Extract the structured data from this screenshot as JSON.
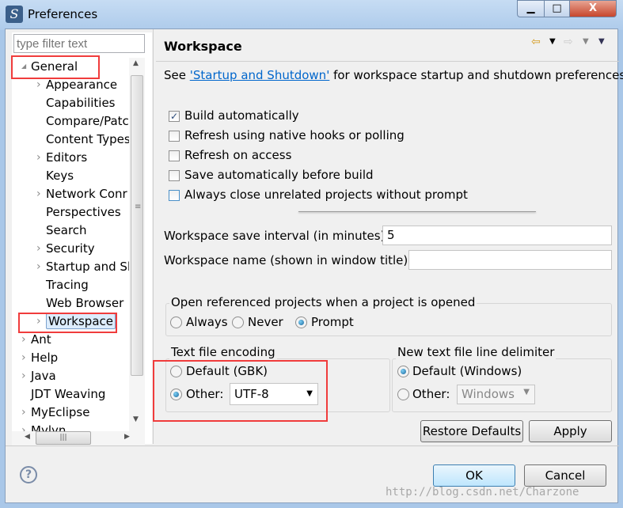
{
  "window": {
    "title": "Preferences",
    "minimize": "▁",
    "maximize": "□",
    "close": "X"
  },
  "sidebar": {
    "filter_placeholder": "type filter text",
    "items": [
      {
        "label": "General",
        "level": 0,
        "expanded": true
      },
      {
        "label": "Appearance",
        "level": 1,
        "arrow": true
      },
      {
        "label": "Capabilities",
        "level": 1
      },
      {
        "label": "Compare/Patc",
        "level": 1
      },
      {
        "label": "Content Types",
        "level": 1
      },
      {
        "label": "Editors",
        "level": 1,
        "arrow": true
      },
      {
        "label": "Keys",
        "level": 1
      },
      {
        "label": "Network Conr",
        "level": 1,
        "arrow": true
      },
      {
        "label": "Perspectives",
        "level": 1
      },
      {
        "label": "Search",
        "level": 1
      },
      {
        "label": "Security",
        "level": 1,
        "arrow": true
      },
      {
        "label": "Startup and Sh",
        "level": 1,
        "arrow": true
      },
      {
        "label": "Tracing",
        "level": 1
      },
      {
        "label": "Web Browser",
        "level": 1
      },
      {
        "label": "Workspace",
        "level": 1,
        "arrow": true,
        "selected": true
      },
      {
        "label": "Ant",
        "level": 0,
        "arrow": true
      },
      {
        "label": "Help",
        "level": 0,
        "arrow": true
      },
      {
        "label": "Java",
        "level": 0,
        "arrow": true
      },
      {
        "label": "JDT Weaving",
        "level": 0
      },
      {
        "label": "MyEclipse",
        "level": 0,
        "arrow": true
      },
      {
        "label": "Mylyn",
        "level": 0,
        "arrow": true
      }
    ]
  },
  "page": {
    "title": "Workspace",
    "see_prefix": "See ",
    "link": "'Startup and Shutdown'",
    "see_suffix": " for workspace startup and shutdown preferences.",
    "checkboxes": [
      {
        "label": "Build automatically",
        "checked": true
      },
      {
        "label": "Refresh using native hooks or polling",
        "checked": false
      },
      {
        "label": "Refresh on access",
        "checked": false
      },
      {
        "label": "Save automatically before build",
        "checked": false
      },
      {
        "label": "Always close unrelated projects without prompt",
        "checked": false
      }
    ],
    "save_interval_label": "Workspace save interval (in minutes):",
    "save_interval_value": "5",
    "ws_name_label": "Workspace name (shown in window title):",
    "ws_name_value": "",
    "open_ref": {
      "label": "Open referenced projects when a project is opened",
      "options": [
        "Always",
        "Never",
        "Prompt"
      ],
      "selected": "Prompt"
    },
    "encoding": {
      "label": "Text file encoding",
      "default": "Default (GBK)",
      "other": "Other:",
      "value": "UTF-8",
      "selected": "Other"
    },
    "delimiter": {
      "label": "New text file line delimiter",
      "default": "Default (Windows)",
      "other": "Other:",
      "value": "Windows",
      "selected": "Default"
    },
    "restore_defaults": "Restore Defaults",
    "apply": "Apply"
  },
  "footer": {
    "ok": "OK",
    "cancel": "Cancel",
    "watermark": "http://blog.csdn.net/Charzone"
  },
  "colors": {
    "highlight": "#f03c3c",
    "link": "#0066cc"
  }
}
